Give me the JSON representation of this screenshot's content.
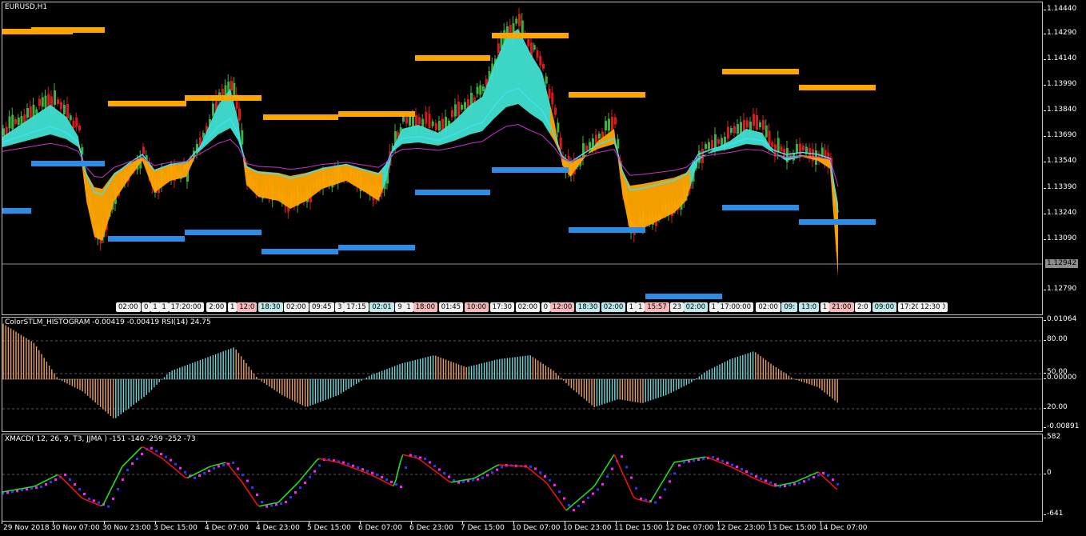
{
  "main": {
    "title": "EURUSD,H1",
    "current_price": "1.12942",
    "price_ticks": [
      "1.14440",
      "1.14290",
      "1.14140",
      "1.13990",
      "1.13840",
      "1.13690",
      "1.13540",
      "1.13390",
      "1.13240",
      "1.13090",
      "1.12790"
    ],
    "session_labels": [
      {
        "text": "02:00",
        "color": "#f0f0f0"
      },
      {
        "text": "0",
        "color": "#f0f0f0"
      },
      {
        "text": "1",
        "color": "#f0f0f0"
      },
      {
        "text": "1",
        "color": "#f0f0f0"
      },
      {
        "text": "17:20:00",
        "color": "#f0f0f0"
      },
      {
        "text": "2:00",
        "color": "#f0f0f0"
      },
      {
        "text": "1",
        "color": "#f0f0f0"
      },
      {
        "text": "12:0",
        "color": "#f4b8b8"
      },
      {
        "text": "18:30",
        "color": "#bfe8ea"
      },
      {
        "text": "02:00",
        "color": "#f0f0f0"
      },
      {
        "text": "09:45",
        "color": "#f0f0f0"
      },
      {
        "text": "3",
        "color": "#f0f0f0"
      },
      {
        "text": "17:15",
        "color": "#f0f0f0"
      },
      {
        "text": "02:01",
        "color": "#bfe8ea"
      },
      {
        "text": "9",
        "color": "#f0f0f0"
      },
      {
        "text": "1",
        "color": "#f0f0f0"
      },
      {
        "text": "18:00",
        "color": "#f4b8b8"
      },
      {
        "text": "01:45",
        "color": "#f0f0f0"
      },
      {
        "text": "10:00",
        "color": "#f4b8b8"
      },
      {
        "text": "17:30",
        "color": "#f0f0f0"
      },
      {
        "text": "02:00",
        "color": "#f0f0f0"
      },
      {
        "text": "0",
        "color": "#f0f0f0"
      },
      {
        "text": "12:00",
        "color": "#f4b8b8"
      },
      {
        "text": "18:30",
        "color": "#bfe8ea"
      },
      {
        "text": "02:00",
        "color": "#bfe8ea"
      },
      {
        "text": "1",
        "color": "#f0f0f0"
      },
      {
        "text": "1",
        "color": "#f0f0f0"
      },
      {
        "text": "15:57",
        "color": "#f4b8b8"
      },
      {
        "text": "23",
        "color": "#f0f0f0"
      },
      {
        "text": "02:00",
        "color": "#bfe8ea"
      },
      {
        "text": "1",
        "color": "#f0f0f0"
      },
      {
        "text": "17:00:00",
        "color": "#f0f0f0"
      },
      {
        "text": "02:00",
        "color": "#f0f0f0"
      },
      {
        "text": "09:",
        "color": "#bfe8ea"
      },
      {
        "text": "13:0",
        "color": "#bfe8ea"
      },
      {
        "text": "1",
        "color": "#f0f0f0"
      },
      {
        "text": "21:00",
        "color": "#f4b8b8"
      },
      {
        "text": "2:0",
        "color": "#f0f0f0"
      },
      {
        "text": "09:00",
        "color": "#bfe8ea"
      },
      {
        "text": "17:20",
        "color": "#f0f0f0"
      },
      {
        "text": "22:30",
        "color": "#f0f0f0"
      },
      {
        "text": "12:30",
        "color": "#f0f0f0"
      }
    ]
  },
  "histogram": {
    "title": "ColorSTLM_HISTOGRAM -0.00419 -0.00419 RSI(14) 24.75",
    "ticks": [
      "0.01064",
      "80.00",
      "50.00",
      "0.00000",
      "20.00",
      "-0.00891"
    ]
  },
  "xmacd": {
    "title": "XMACD( 12, 26, 9, T3, JJMA ) -151 -140 -259 -252 -73",
    "ticks": [
      "582",
      "0",
      "-641"
    ]
  },
  "time_axis": [
    "29 Nov 2018",
    "30 Nov 07:00",
    "30 Nov 23:00",
    "3 Dec 15:00",
    "4 Dec 07:00",
    "4 Dec 23:00",
    "5 Dec 15:00",
    "6 Dec 07:00",
    "6 Dec 23:00",
    "7 Dec 15:00",
    "10 Dec 07:00",
    "10 Dec 23:00",
    "11 Dec 15:00",
    "12 Dec 07:00",
    "12 Dec 23:00",
    "13 Dec 15:00",
    "14 Dec 07:00"
  ],
  "colors": {
    "background": "#000000",
    "bull_candle": "#3cb43c",
    "bear_candle": "#e01818",
    "resistance": "#ffa500",
    "support": "#2d8ce6",
    "cloud_bull": "#40e0d0",
    "cloud_bear": "#ffa500",
    "hist_bull": "#6fd8dc",
    "hist_bear": "#e8a060",
    "macd_up": "#22dd22",
    "macd_down": "#ee1111",
    "signal": "#ff22ff"
  }
}
